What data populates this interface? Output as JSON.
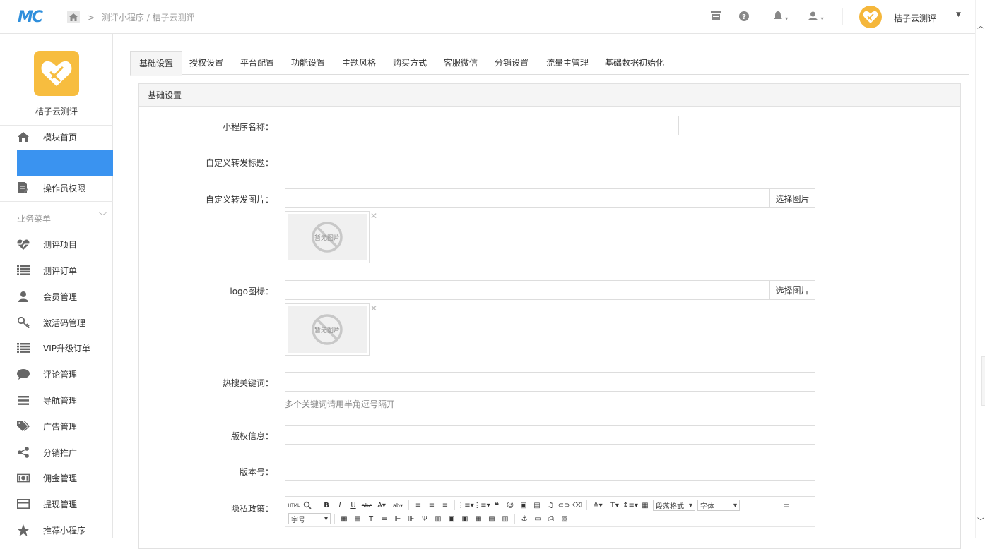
{
  "header": {
    "logo": "MC",
    "breadcrumb": "测评小程序 / 桔子云测评",
    "username": "桔子云测评"
  },
  "sidebar": {
    "app_name": "桔子云测评",
    "top_items": [
      {
        "label": "模块首页",
        "icon": "home-icon"
      },
      {
        "label": "",
        "icon": ""
      },
      {
        "label": "操作员权限",
        "icon": "edit-doc-icon"
      }
    ],
    "group_label": "业务菜单",
    "items": [
      {
        "label": "测评项目",
        "icon": "heartbeat-icon"
      },
      {
        "label": "测评订单",
        "icon": "list-icon"
      },
      {
        "label": "会员管理",
        "icon": "user-icon"
      },
      {
        "label": "激活码管理",
        "icon": "key-icon"
      },
      {
        "label": "VIP升级订单",
        "icon": "list-icon"
      },
      {
        "label": "评论管理",
        "icon": "comment-icon"
      },
      {
        "label": "导航管理",
        "icon": "bars-icon"
      },
      {
        "label": "广告管理",
        "icon": "tags-icon"
      },
      {
        "label": "分销推广",
        "icon": "share-icon"
      },
      {
        "label": "佣金管理",
        "icon": "money-icon"
      },
      {
        "label": "提现管理",
        "icon": "card-icon"
      },
      {
        "label": "推荐小程序",
        "icon": "star-icon"
      }
    ]
  },
  "tabs": [
    "基础设置",
    "授权设置",
    "平台配置",
    "功能设置",
    "主题风格",
    "购买方式",
    "客服微信",
    "分销设置",
    "流量主管理",
    "基础数据初始化"
  ],
  "active_tab": "基础设置",
  "panel": {
    "title": "基础设置",
    "fields": {
      "app_name": {
        "label": "小程序名称：",
        "value": ""
      },
      "share_title": {
        "label": "自定义转发标题：",
        "value": ""
      },
      "share_image": {
        "label": "自定义转发图片：",
        "value": "",
        "button": "选择图片",
        "thumb_text": "暂无图片"
      },
      "logo": {
        "label": "logo图标：",
        "value": "",
        "button": "选择图片",
        "thumb_text": "暂无图片"
      },
      "hot_keywords": {
        "label": "热搜关键词：",
        "value": "",
        "help": "多个关键词请用半角逗号隔开"
      },
      "copyright": {
        "label": "版权信息：",
        "value": ""
      },
      "version": {
        "label": "版本号：",
        "value": ""
      },
      "privacy": {
        "label": "隐私政策："
      }
    },
    "editor": {
      "paragraph_format": "段落格式",
      "font_family": "字体",
      "font_size": "字号"
    }
  }
}
